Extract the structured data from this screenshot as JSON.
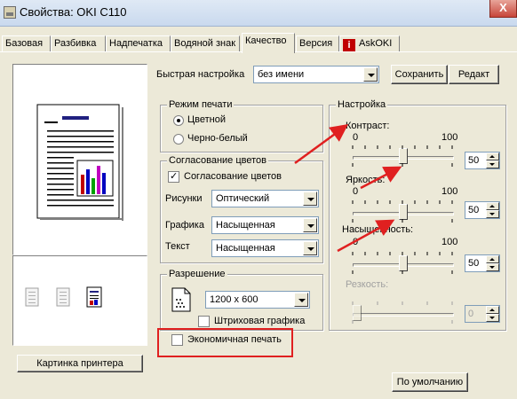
{
  "window": {
    "title": "Свойства: OKI C110",
    "close_label": "X"
  },
  "tabs": [
    {
      "label": "Базовая"
    },
    {
      "label": "Разбивка"
    },
    {
      "label": "Надпечатка"
    },
    {
      "label": "Водяной знак"
    },
    {
      "label": "Качество",
      "active": true
    },
    {
      "label": "Версия"
    },
    {
      "label": "AskOKI",
      "icon": "info-icon"
    }
  ],
  "preview": {
    "printer_button": "Картинка принтера"
  },
  "quick_setup": {
    "label": "Быстрая настройка",
    "value": "без имени",
    "save_button": "Сохранить",
    "edit_button": "Редакт"
  },
  "print_mode": {
    "group_label": "Режим печати",
    "color": "Цветной",
    "mono": "Черно-белый",
    "selected": "color"
  },
  "color_matching": {
    "group_label": "Согласование цветов",
    "checkbox": "Согласование цветов",
    "checked": true,
    "pictures_label": "Рисунки",
    "pictures_value": "Оптический",
    "graphics_label": "Графика",
    "graphics_value": "Насыщенная",
    "text_label": "Текст",
    "text_value": "Насыщенная"
  },
  "resolution": {
    "group_label": "Разрешение",
    "value": "1200 x 600",
    "line_art": "Штриховая графика",
    "line_art_checked": false
  },
  "economy": {
    "label": "Экономичная печать",
    "checked": false
  },
  "settings": {
    "group_label": "Настройка",
    "sliders": [
      {
        "label": "Контраст:",
        "min": "0",
        "max": "100",
        "value": "50",
        "level": 0.5,
        "enabled": true
      },
      {
        "label": "Яркость:",
        "min": "0",
        "max": "100",
        "value": "50",
        "level": 0.5,
        "enabled": true
      },
      {
        "label": "Насыщенность:",
        "min": "0",
        "max": "100",
        "value": "50",
        "level": 0.5,
        "enabled": true
      },
      {
        "label": "Резкость:",
        "min": "",
        "max": "",
        "value": "0",
        "level": 0,
        "enabled": false
      }
    ]
  },
  "defaults_button": "По умолчанию",
  "annotation_color": "#e02020"
}
